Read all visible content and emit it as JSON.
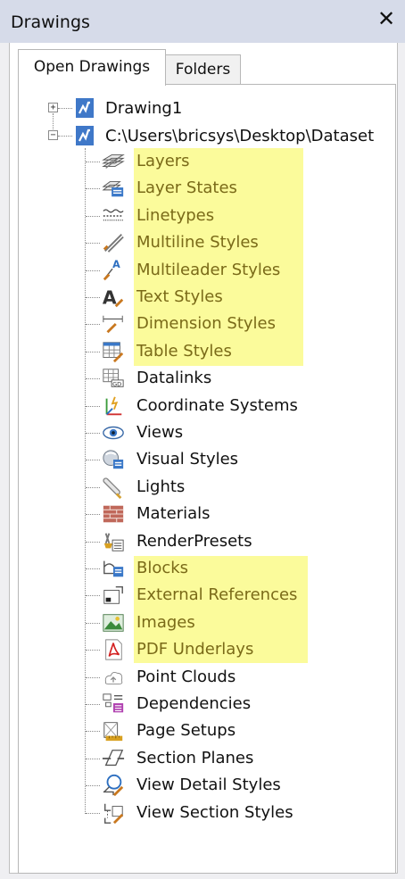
{
  "panel": {
    "title": "Drawings",
    "close_glyph": "✕"
  },
  "tabs": [
    {
      "label": "Open Drawings",
      "active": true
    },
    {
      "label": "Folders",
      "active": false
    }
  ],
  "tree": {
    "roots": [
      {
        "label": "Drawing1",
        "expander": "+"
      },
      {
        "label": "C:\\Users\\bricsys\\Desktop\\Dataset",
        "expander": "−"
      }
    ],
    "highlight_color": "#fbfb9b",
    "highlighted_text_color": "#7a6a18",
    "items": [
      {
        "label": "Layers",
        "icon": "layers-icon",
        "highlighted": true
      },
      {
        "label": "Layer States",
        "icon": "layer-states-icon",
        "highlighted": true
      },
      {
        "label": "Linetypes",
        "icon": "linetypes-icon",
        "highlighted": true
      },
      {
        "label": "Multiline Styles",
        "icon": "multiline-styles-icon",
        "highlighted": true
      },
      {
        "label": "Multileader Styles",
        "icon": "multileader-styles-icon",
        "highlighted": true
      },
      {
        "label": "Text Styles",
        "icon": "text-styles-icon",
        "highlighted": true
      },
      {
        "label": "Dimension Styles",
        "icon": "dimension-styles-icon",
        "highlighted": true
      },
      {
        "label": "Table Styles",
        "icon": "table-styles-icon",
        "highlighted": true
      },
      {
        "label": "Datalinks",
        "icon": "datalinks-icon",
        "highlighted": false
      },
      {
        "label": "Coordinate Systems",
        "icon": "coordinate-systems-icon",
        "highlighted": false
      },
      {
        "label": "Views",
        "icon": "views-eye-icon",
        "highlighted": false
      },
      {
        "label": "Visual Styles",
        "icon": "visual-styles-icon",
        "highlighted": false
      },
      {
        "label": "Lights",
        "icon": "lights-icon",
        "highlighted": false
      },
      {
        "label": "Materials",
        "icon": "materials-icon",
        "highlighted": false
      },
      {
        "label": "RenderPresets",
        "icon": "render-presets-icon",
        "highlighted": false
      },
      {
        "label": "Blocks",
        "icon": "blocks-icon",
        "highlighted": true
      },
      {
        "label": "External References",
        "icon": "external-references-icon",
        "highlighted": true
      },
      {
        "label": "Images",
        "icon": "images-icon",
        "highlighted": true
      },
      {
        "label": "PDF Underlays",
        "icon": "pdf-underlays-icon",
        "highlighted": true
      },
      {
        "label": "Point Clouds",
        "icon": "point-clouds-icon",
        "highlighted": false
      },
      {
        "label": "Dependencies",
        "icon": "dependencies-icon",
        "highlighted": false
      },
      {
        "label": "Page Setups",
        "icon": "page-setups-icon",
        "highlighted": false
      },
      {
        "label": "Section Planes",
        "icon": "section-planes-icon",
        "highlighted": false
      },
      {
        "label": "View Detail Styles",
        "icon": "view-detail-styles-icon",
        "highlighted": false
      },
      {
        "label": "View Section Styles",
        "icon": "view-section-styles-icon",
        "highlighted": false
      }
    ]
  }
}
